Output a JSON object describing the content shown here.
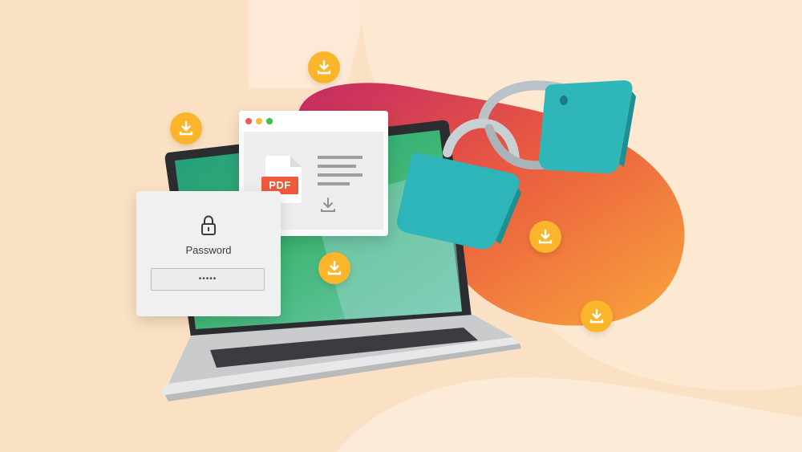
{
  "password_dialog": {
    "label": "Password",
    "masked_value": "•••••",
    "icon": "lock-icon"
  },
  "pdf_window": {
    "file_badge": "PDF",
    "icons": [
      "file-icon",
      "download-icon"
    ]
  },
  "download_badges": {
    "icon": "download-icon",
    "color": "#fbb52a"
  },
  "colors": {
    "background": "#fbe1c4",
    "blob_orange": "#f0713e",
    "blob_magenta": "#c93063",
    "padlock_teal": "#2fb8bd",
    "pdf_red": "#ee5a3e"
  }
}
